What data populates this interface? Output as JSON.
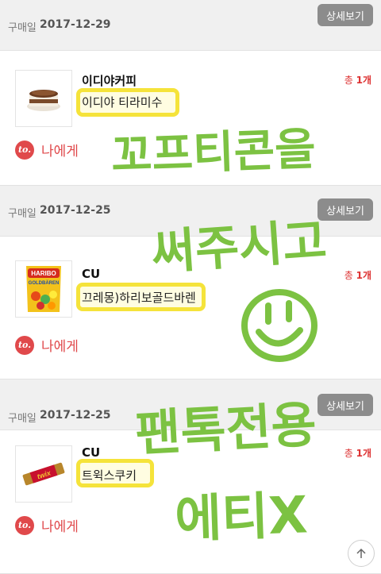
{
  "orders": [
    {
      "date_label": "구매일",
      "date": "2017-12-29",
      "detail_label": "상세보기",
      "brand": "이디야커피",
      "product": "이디야 티라미수",
      "total_prefix": "총",
      "total_count": "1개",
      "to_badge": "to.",
      "to_label": "나에게",
      "thumb_icon": "tiramisu-cake-icon"
    },
    {
      "date_label": "구매일",
      "date": "2017-12-25",
      "detail_label": "상세보기",
      "brand": "CU",
      "product": "끄레몽)하리보골드바렌",
      "total_prefix": "총",
      "total_count": "1개",
      "to_badge": "to.",
      "to_label": "나에게",
      "thumb_icon": "haribo-bag-icon",
      "thumb_text": [
        "HARIBO",
        "GOLDBÄREN"
      ]
    },
    {
      "date_label": "구매일",
      "date": "2017-12-25",
      "detail_label": "상세보기",
      "brand": "CU",
      "product": "트윅스쿠키",
      "total_prefix": "총",
      "total_count": "1개",
      "to_badge": "to.",
      "to_label": "나에게",
      "thumb_icon": "twix-bar-icon",
      "thumb_text": [
        "twix"
      ]
    }
  ],
  "handwriting": {
    "line1": "꼬프티콘을",
    "line2": "써주시고",
    "line3": "팬톡전용",
    "line4": "에티X",
    "color": "#7cc242",
    "smiley_icon": "smiley-face-icon"
  },
  "highlight_color": "#f5e33a",
  "accent_red": "#e0494b",
  "scroll_top_icon": "arrow-up-icon"
}
